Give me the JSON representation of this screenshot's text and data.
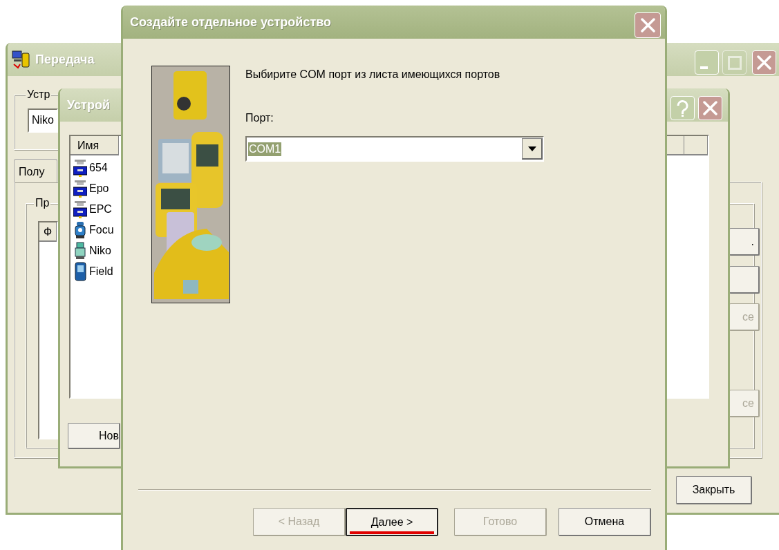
{
  "back_window": {
    "title": "Передача",
    "device_group": {
      "label": "Устр",
      "value": "Niko"
    },
    "tabs": [
      {
        "label": "Полу",
        "selected": true
      }
    ],
    "inner_group": {
      "label": "Пр"
    },
    "list_header": "Ф",
    "side_buttons": [
      {
        "label": ".",
        "disabled": false
      },
      {
        "disabled": false
      },
      {
        "label": "се",
        "disabled": true
      },
      {
        "label": "се",
        "disabled": true
      }
    ],
    "close_button": "Закрыть"
  },
  "device_window": {
    "title": "Устрой",
    "column_1": "Имя",
    "items": [
      {
        "name": "654",
        "kind": "receiver"
      },
      {
        "name": "Epo",
        "kind": "receiver"
      },
      {
        "name": "EPC",
        "kind": "receiver"
      },
      {
        "name": "Focu",
        "kind": "total-station"
      },
      {
        "name": "Niko",
        "kind": "station-green"
      },
      {
        "name": "Field",
        "kind": "handheld"
      }
    ],
    "new_button": "Нов"
  },
  "wizard": {
    "title": "Создайте отдельное устройство",
    "instruction": "Выбирите COM порт из листа имеющихся портов",
    "port_label": "Порт:",
    "port": {
      "value": "COM1",
      "selected": true
    },
    "buttons": [
      {
        "label": "< Назад",
        "disabled": true,
        "default": false,
        "underlined": false
      },
      {
        "label": "Далее >",
        "disabled": false,
        "default": true,
        "underlined": true
      },
      {
        "label": "Готово",
        "disabled": true,
        "default": false,
        "underlined": false
      },
      {
        "label": "Отмена",
        "disabled": false,
        "default": false,
        "underlined": false
      }
    ]
  }
}
